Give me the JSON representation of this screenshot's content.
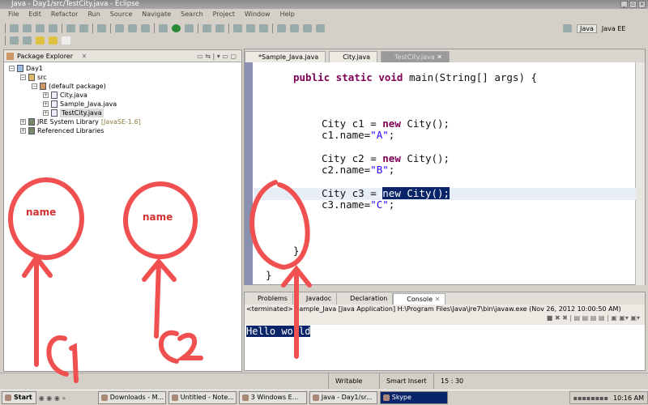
{
  "window": {
    "title": "Java - Day1/src/TestCity.java - Eclipse"
  },
  "menu": [
    "File",
    "Edit",
    "Refactor",
    "Run",
    "Source",
    "Navigate",
    "Search",
    "Project",
    "Window",
    "Help"
  ],
  "perspectives": {
    "java": "Java",
    "java_ee": "Java EE"
  },
  "package_explorer": {
    "title": "Package Explorer",
    "items": [
      {
        "label": "Day1"
      },
      {
        "label": "src"
      },
      {
        "label": "(default package)"
      },
      {
        "label": "City.java"
      },
      {
        "label": "Sample_Java.java"
      },
      {
        "label": "TestCity.java"
      },
      {
        "label": "JRE System Library",
        "suffix": "[JavaSE-1.6]"
      },
      {
        "label": "Referenced Libraries"
      }
    ]
  },
  "editor": {
    "tabs": [
      {
        "label": "*Sample_Java.java"
      },
      {
        "label": "City.java"
      },
      {
        "label": "TestCity.java"
      }
    ],
    "code": {
      "sig_kw": "public static void",
      "sig_rest": " main(String[] args) {",
      "l1a": "City c1 = ",
      "l1kw": "new",
      "l1b": " City();",
      "l2a": "c1.name=",
      "l2s": "\"A\"",
      "l2b": ";",
      "l3a": "City c2 = ",
      "l3kw": "new",
      "l3b": " City();",
      "l4a": "c2.name=",
      "l4s": "\"B\"",
      "l4b": ";",
      "l5a": "City c3 = ",
      "l5sel": "new City();",
      "l6a": "c3.name=",
      "l6s": "\"C\"",
      "l6b": ";",
      "close1": "}",
      "close2": "}"
    }
  },
  "bottom": {
    "tabs": [
      {
        "label": "Problems"
      },
      {
        "label": "Javadoc"
      },
      {
        "label": "Declaration"
      },
      {
        "label": "Console"
      }
    ],
    "terminated": "<terminated> Sample_Java [Java Application] H:\\Program Files\\Java\\jre7\\bin\\javaw.exe (Nov 26, 2012 10:00:50 AM)",
    "output": "Hello world"
  },
  "status": {
    "writable": "Writable",
    "insert": "Smart Insert",
    "position": "15 : 30"
  },
  "taskbar": {
    "start": "Start",
    "tasks": [
      "Downloads - M...",
      "Untitled - Note...",
      "3 Windows E...",
      "Java - Day1/sr...",
      "Skype"
    ],
    "clock": "10:16 AM"
  },
  "annotations": {
    "circle1": "name",
    "circle2": "name",
    "arrow1": "C1",
    "arrow2": "C2"
  },
  "colors": {
    "annotation": "#f05050",
    "keyword": "#7f0055",
    "string": "#2a00ff",
    "selection": "#0a246a"
  }
}
